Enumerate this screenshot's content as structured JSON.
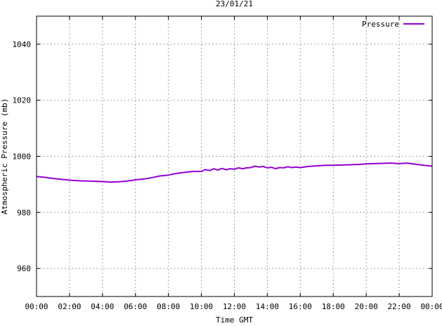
{
  "chart_data": {
    "type": "line",
    "title": "23/01/21",
    "xlabel": "Time GMT",
    "ylabel": "Atmospheric Pressure (mb)",
    "xlim": [
      0,
      24
    ],
    "ylim": [
      950,
      1050
    ],
    "x_ticks": [
      {
        "x": 0,
        "label": "00:00"
      },
      {
        "x": 2,
        "label": "02:00"
      },
      {
        "x": 4,
        "label": "04:00"
      },
      {
        "x": 6,
        "label": "06:00"
      },
      {
        "x": 8,
        "label": "08:00"
      },
      {
        "x": 10,
        "label": "10:00"
      },
      {
        "x": 12,
        "label": "12:00"
      },
      {
        "x": 14,
        "label": "14:00"
      },
      {
        "x": 16,
        "label": "16:00"
      },
      {
        "x": 18,
        "label": "18:00"
      },
      {
        "x": 20,
        "label": "20:00"
      },
      {
        "x": 22,
        "label": "22:00"
      },
      {
        "x": 24,
        "label": "00:00"
      }
    ],
    "y_ticks": [
      {
        "y": 960,
        "label": "960"
      },
      {
        "y": 980,
        "label": "980"
      },
      {
        "y": 1000,
        "label": "1000"
      },
      {
        "y": 1020,
        "label": "1020"
      },
      {
        "y": 1040,
        "label": "1040"
      }
    ],
    "grid": true,
    "legend_position": "top-right",
    "series": [
      {
        "name": "Pressure",
        "color": "#9400d3",
        "x": [
          0,
          0.5,
          1,
          1.5,
          2,
          2.5,
          3,
          3.5,
          4,
          4.5,
          5,
          5.5,
          6,
          6.5,
          7,
          7.5,
          8,
          8.5,
          9,
          9.5,
          10,
          10.25,
          10.5,
          10.75,
          11,
          11.25,
          11.5,
          11.75,
          12,
          12.25,
          12.5,
          12.75,
          13,
          13.25,
          13.5,
          13.75,
          14,
          14.25,
          14.5,
          14.75,
          15,
          15.25,
          15.5,
          15.75,
          16,
          16.5,
          17,
          17.5,
          18,
          18.5,
          19,
          19.5,
          20,
          20.5,
          21,
          21.5,
          22,
          22.5,
          23,
          23.5,
          24
        ],
        "y": [
          992.8,
          992.5,
          992.1,
          991.8,
          991.5,
          991.3,
          991.2,
          991.1,
          991.0,
          990.8,
          990.9,
          991.2,
          991.6,
          991.9,
          992.4,
          993.0,
          993.3,
          993.9,
          994.3,
          994.6,
          994.6,
          995.3,
          994.9,
          995.6,
          995.1,
          995.7,
          995.2,
          995.6,
          995.4,
          995.9,
          995.6,
          995.9,
          996.0,
          996.5,
          996.2,
          996.4,
          995.9,
          996.1,
          995.6,
          996.0,
          995.9,
          996.3,
          996.0,
          996.2,
          996.0,
          996.4,
          996.6,
          996.8,
          996.8,
          996.9,
          997.0,
          997.1,
          997.3,
          997.4,
          997.5,
          997.6,
          997.4,
          997.6,
          997.2,
          996.8,
          996.5
        ]
      }
    ]
  }
}
